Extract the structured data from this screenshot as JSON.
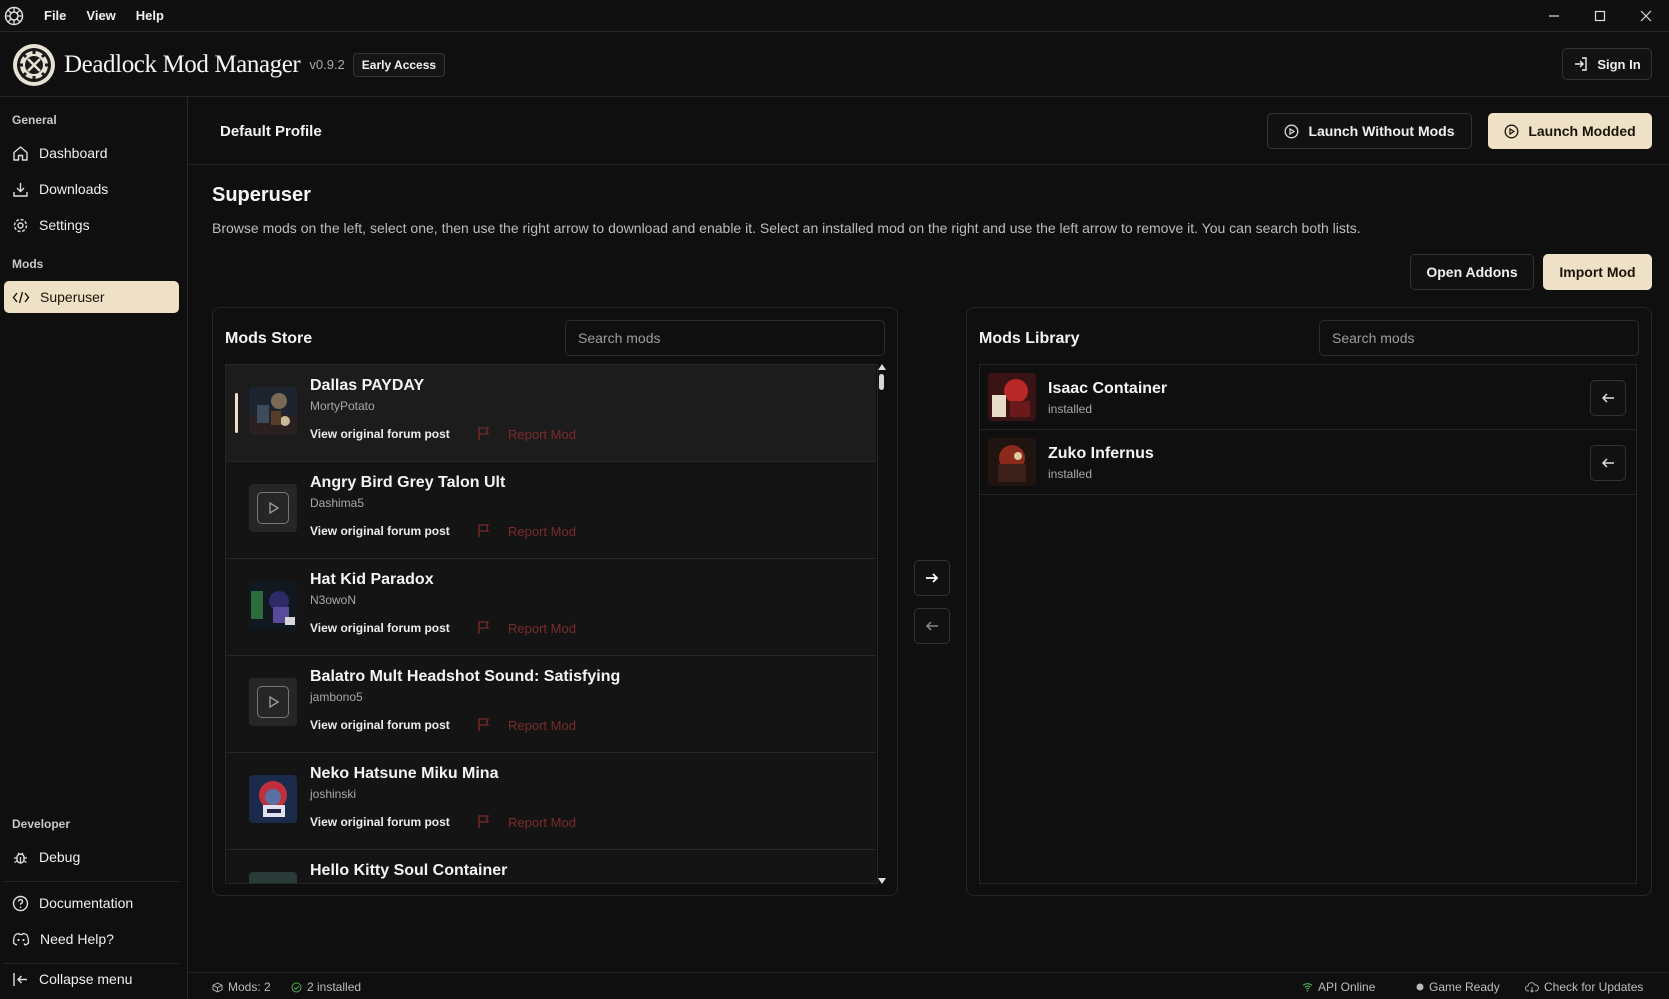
{
  "menu": {
    "file": "File",
    "view": "View",
    "help": "Help"
  },
  "header": {
    "title": "Deadlock Mod Manager",
    "version": "v0.9.2",
    "badge": "Early Access",
    "sign_in": "Sign In"
  },
  "sidebar": {
    "general_label": "General",
    "dashboard": "Dashboard",
    "downloads": "Downloads",
    "settings": "Settings",
    "mods_label": "Mods",
    "superuser": "Superuser",
    "developer_label": "Developer",
    "debug": "Debug",
    "documentation": "Documentation",
    "need_help": "Need Help?",
    "collapse": "Collapse menu"
  },
  "profile": {
    "name": "Default Profile",
    "launch_without_mods": "Launch Without Mods",
    "launch_modded": "Launch Modded"
  },
  "page": {
    "title": "Superuser",
    "description": "Browse mods on the left, select one, then use the right arrow to download and enable it. Select an installed mod on the right and use the left arrow to remove it. You can search both lists.",
    "open_addons": "Open Addons",
    "import_mod": "Import Mod"
  },
  "store": {
    "title": "Mods Store",
    "search_placeholder": "Search mods",
    "link_label": "View original forum post",
    "report_label": "Report Mod",
    "mods": [
      {
        "name": "Dallas PAYDAY",
        "author": "MortyPotato",
        "thumb": "image",
        "selected": true
      },
      {
        "name": "Angry Bird Grey Talon Ult",
        "author": "Dashima5",
        "thumb": "audio",
        "selected": false
      },
      {
        "name": "Hat Kid Paradox",
        "author": "N3owoN",
        "thumb": "image",
        "selected": false
      },
      {
        "name": "Balatro Mult Headshot Sound: Satisfying",
        "author": "jambono5",
        "thumb": "audio",
        "selected": false
      },
      {
        "name": "Neko Hatsune Miku Mina",
        "author": "joshinski",
        "thumb": "image",
        "selected": false
      },
      {
        "name": "Hello Kitty Soul Container",
        "author": "",
        "thumb": "image",
        "selected": false
      }
    ]
  },
  "library": {
    "title": "Mods Library",
    "search_placeholder": "Search mods",
    "mods": [
      {
        "name": "Isaac Container",
        "status": "installed"
      },
      {
        "name": "Zuko Infernus",
        "status": "installed"
      }
    ]
  },
  "status": {
    "mods_count": "Mods: 2",
    "installed": "2 installed",
    "api": "API Online",
    "game": "Game Ready",
    "updates": "Check for Updates"
  },
  "colors": {
    "accent": "#efe1c6",
    "background": "#0f0f0f",
    "border": "#262626",
    "danger": "#7a2a2a",
    "online": "#4caf50"
  }
}
